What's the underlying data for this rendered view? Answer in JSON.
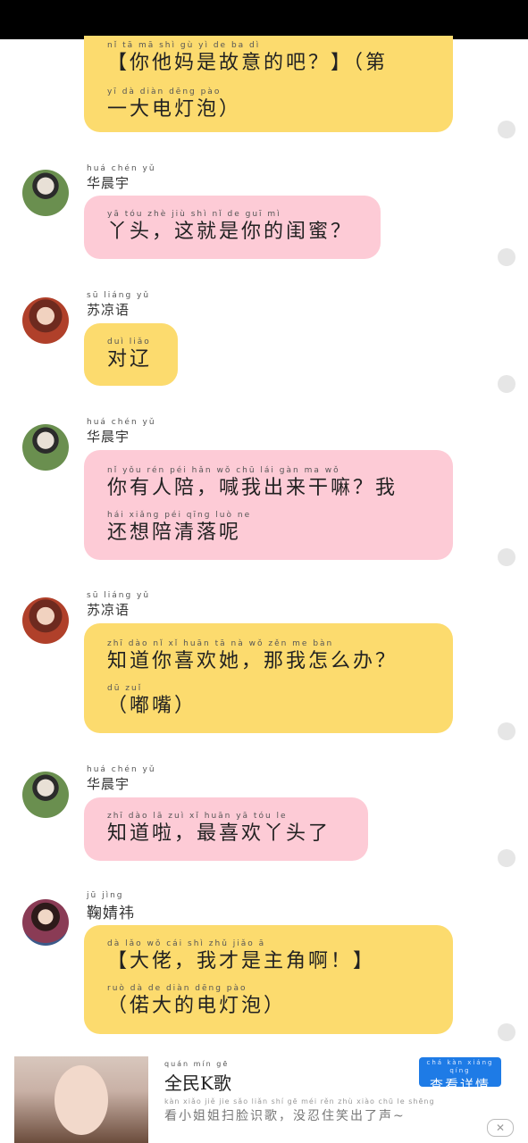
{
  "messages": [
    {
      "sender": "",
      "color": "yellow",
      "lines": [
        {
          "pinyin": "nǐ  tā  mā  shì  gù  yì  de  ba              dì",
          "text": "【你他妈是故意的吧？】（第"
        },
        {
          "pinyin": "yī  dà  diàn dēng pào",
          "text": "一大电灯泡）"
        }
      ]
    },
    {
      "sender": "华晨宇",
      "sender_pinyin": "huá chén yǔ",
      "color": "pink",
      "lines": [
        {
          "pinyin": "yā tóu    zhè jiù shì nǐ  de  guī mì",
          "text": "丫头，这就是你的闺蜜？"
        }
      ]
    },
    {
      "sender": "苏凉语",
      "sender_pinyin": "sū liáng yǔ",
      "color": "yellow",
      "lines": [
        {
          "pinyin": "duì liǎo",
          "text": "对辽"
        }
      ]
    },
    {
      "sender": "华晨宇",
      "sender_pinyin": "huá chén yǔ",
      "color": "pink",
      "lines": [
        {
          "pinyin": "nǐ yǒu rén péi    hǎn wǒ chū lái gàn ma      wǒ",
          "text": "你有人陪，喊我出来干嘛？我"
        },
        {
          "pinyin": "hái xiǎng péi qīng luò ne",
          "text": "还想陪清落呢"
        }
      ]
    },
    {
      "sender": "苏凉语",
      "sender_pinyin": "sū liáng yǔ",
      "color": "yellow",
      "lines": [
        {
          "pinyin": "zhī dào nǐ  xǐ huān tā    nà wǒ zěn me bàn",
          "text": "知道你喜欢她，那我怎么办？"
        },
        {
          "pinyin": "     dū  zuǐ",
          "text": "（嘟嘴）"
        }
      ]
    },
    {
      "sender": "华晨宇",
      "sender_pinyin": "huá chén yǔ",
      "color": "pink",
      "lines": [
        {
          "pinyin": "zhī dào lā    zuì xǐ huān yā tóu le",
          "text": "知道啦，最喜欢丫头了"
        }
      ]
    },
    {
      "sender": "鞠婧祎",
      "sender_pinyin": "jū jìng",
      "color": "yellow",
      "lines": [
        {
          "pinyin": "  dà lǎo    wǒ cái shì zhǔ jiǎo ā",
          "text": "【大佬，我才是主角啊！】"
        },
        {
          "pinyin": "   ruò dà de diàn dēng pào",
          "text": "（偌大的电灯泡）"
        }
      ]
    }
  ],
  "ad": {
    "title_pinyin": "quán mín   gē",
    "title": "全民K歌",
    "description_pinyin": "kàn xiǎo jiě jie sǎo liǎn shí gē    méi rěn zhù xiào chū le shēng",
    "description": "看小姐姐扫脸识歌，没忍住笑出了声~",
    "button_pinyin": "chá kàn xiáng qíng",
    "button_label": "查看详情",
    "close_label": "✕"
  }
}
